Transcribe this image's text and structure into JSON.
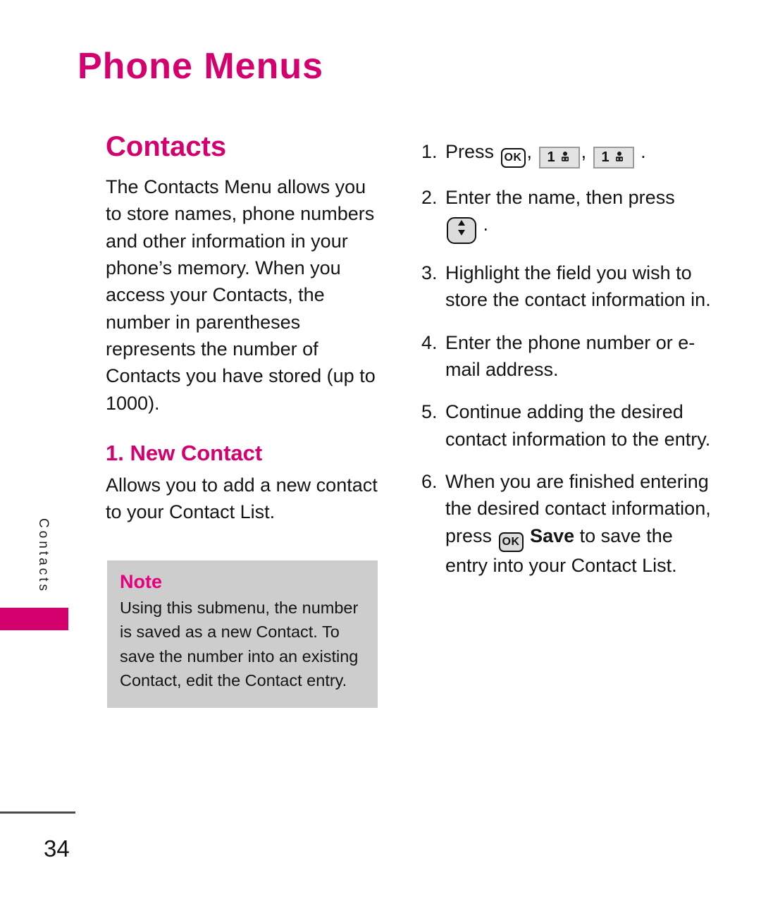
{
  "page": {
    "title": "Phone Menus",
    "number": "34",
    "side_tab_label": "Contacts",
    "accent_color": "#D4006E",
    "note_bg_color": "#CDCDCD"
  },
  "left_column": {
    "heading": "Contacts",
    "intro": "The Contacts Menu allows you to store names, phone numbers and other information in your phone’s memory. When you access your Contacts, the number in parentheses represents the number of Contacts you have stored (up to 1000).",
    "subheading": "1. New Contact",
    "sub_body": "Allows you to add a new contact to your Contact List.",
    "note": {
      "title": "Note",
      "body": "Using this submenu, the number is saved as a new Contact. To save the number into an existing Contact, edit the Contact entry."
    }
  },
  "right_column": {
    "steps": [
      {
        "num": "1.",
        "pre": "Press",
        "keys": [
          "ok-key",
          "one-contacts-key",
          "one-contacts-key"
        ],
        "post": "."
      },
      {
        "num": "2.",
        "pre": "Enter the name, then press",
        "keys": [
          "navigation-key"
        ],
        "post": "."
      },
      {
        "num": "3.",
        "text": "Highlight the field you wish to store the contact information in."
      },
      {
        "num": "4.",
        "text": "Enter the phone number or e-mail address."
      },
      {
        "num": "5.",
        "text": "Continue adding the desired contact information to the entry."
      },
      {
        "num": "6.",
        "pre": "When you are finished entering the desired contact information, press",
        "keys": [
          "ok-key-shaded"
        ],
        "bold": "Save",
        "post": "to save the entry into your Contact List."
      }
    ],
    "key_labels": {
      "ok": "OK",
      "one": "1"
    }
  }
}
